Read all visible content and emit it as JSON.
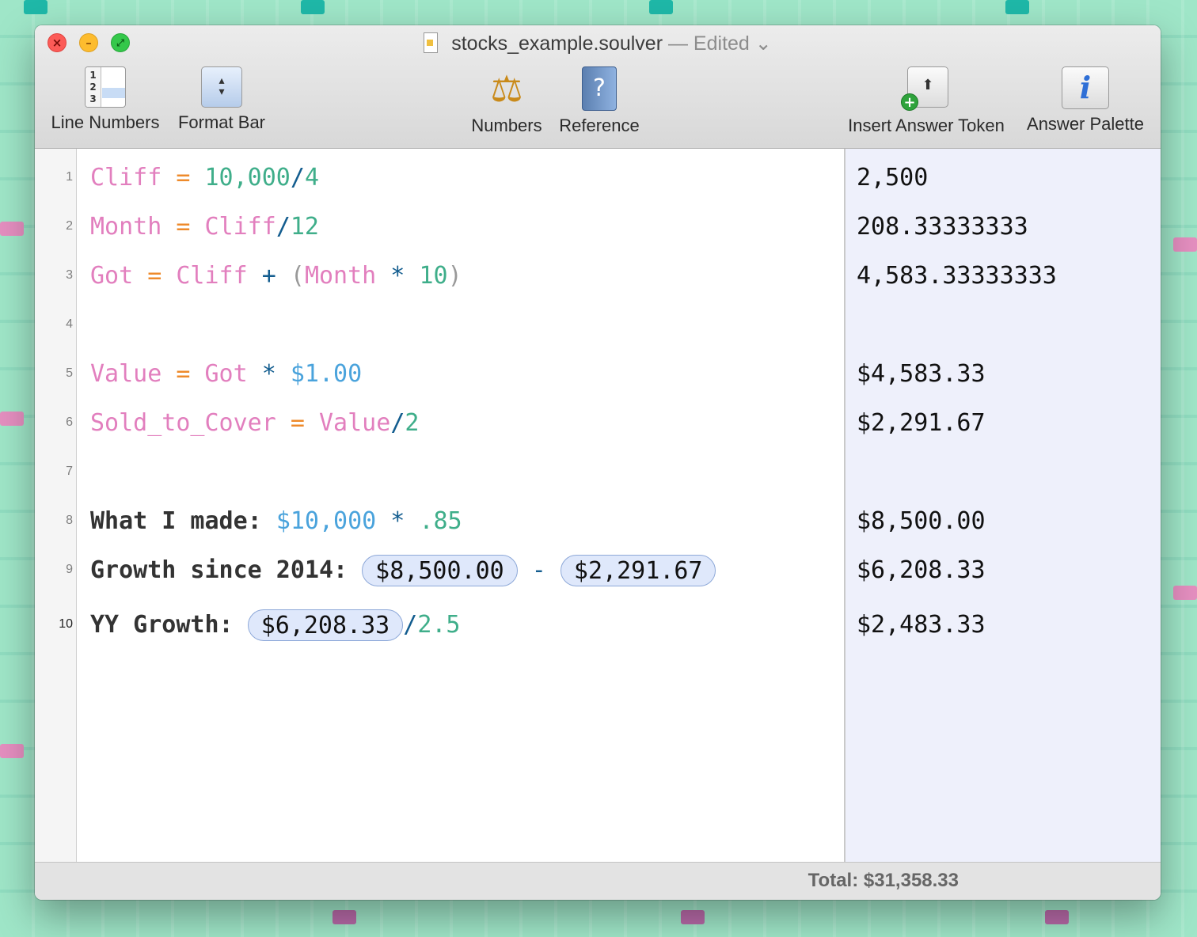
{
  "window": {
    "filename": "stocks_example.soulver",
    "edited_label": "— Edited ⌄"
  },
  "toolbar": {
    "line_numbers_label": "Line Numbers",
    "format_bar_label": "Format Bar",
    "numbers_label": "Numbers",
    "reference_label": "Reference",
    "insert_answer_token_label": "Insert Answer Token",
    "answer_palette_label": "Answer Palette"
  },
  "gutter": {
    "line_numbers": [
      "1",
      "2",
      "3",
      "4",
      "5",
      "6",
      "7",
      "8",
      "9",
      "10"
    ]
  },
  "editor": {
    "lines": [
      {
        "parts": [
          [
            "var",
            "Cliff"
          ],
          [
            "eq",
            " = "
          ],
          [
            "num",
            "10,000"
          ],
          [
            "op",
            "/"
          ],
          [
            "num",
            "4"
          ]
        ]
      },
      {
        "parts": [
          [
            "var",
            "Month"
          ],
          [
            "eq",
            " = "
          ],
          [
            "var",
            "Cliff"
          ],
          [
            "op",
            "/"
          ],
          [
            "num",
            "12"
          ]
        ]
      },
      {
        "parts": [
          [
            "var",
            "Got"
          ],
          [
            "eq",
            " = "
          ],
          [
            "var",
            "Cliff"
          ],
          [
            "op",
            " + "
          ],
          [
            "par",
            "("
          ],
          [
            "var",
            "Month"
          ],
          [
            "op",
            " * "
          ],
          [
            "num",
            "10"
          ],
          [
            "par",
            ")"
          ]
        ]
      },
      {
        "parts": []
      },
      {
        "parts": [
          [
            "var",
            "Value"
          ],
          [
            "eq",
            " = "
          ],
          [
            "var",
            "Got"
          ],
          [
            "op",
            " * "
          ],
          [
            "cur",
            "$1.00"
          ]
        ]
      },
      {
        "parts": [
          [
            "var",
            "Sold_to_Cover"
          ],
          [
            "eq",
            " = "
          ],
          [
            "var",
            "Value"
          ],
          [
            "op",
            "/"
          ],
          [
            "num",
            "2"
          ]
        ]
      },
      {
        "parts": []
      },
      {
        "parts": [
          [
            "label",
            "What I made: "
          ],
          [
            "cur",
            "$10,000"
          ],
          [
            "op",
            " * "
          ],
          [
            "num",
            ".85"
          ]
        ]
      },
      {
        "parts": [
          [
            "label",
            "Growth since 2014: "
          ],
          [
            "token",
            "$8,500.00"
          ],
          [
            "op",
            " - "
          ],
          [
            "token",
            "$2,291.67"
          ]
        ]
      },
      {
        "parts": [
          [
            "label",
            "YY Growth: "
          ],
          [
            "token",
            "$6,208.33"
          ],
          [
            "op",
            "/"
          ],
          [
            "num",
            "2.5"
          ]
        ]
      }
    ]
  },
  "answers": [
    "2,500",
    "208.33333333",
    "4,583.33333333",
    "",
    "$4,583.33",
    "$2,291.67",
    "",
    "$8,500.00",
    "$6,208.33",
    "$2,483.33"
  ],
  "status": {
    "total_text": "Total:  $31,358.33"
  }
}
